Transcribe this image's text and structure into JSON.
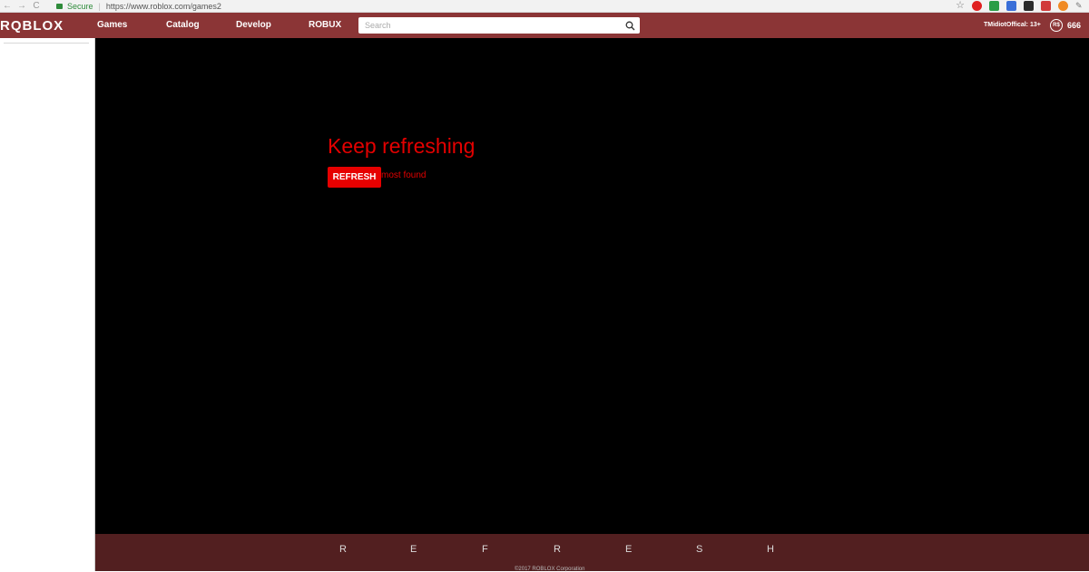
{
  "browser": {
    "secure_label": "Secure",
    "separator": "|",
    "url": "https://www.roblox.com/games2",
    "back": "←",
    "forward": "→",
    "reload": "C",
    "bookmark_icon": "star-icon",
    "extension_colors": [
      "#e02020",
      "#2a9d46",
      "#3a6fd8",
      "#2b2b2b",
      "#d13b3b",
      "#f08a24"
    ]
  },
  "header": {
    "logo": "RQBLOX",
    "nav": [
      "Games",
      "Catalog",
      "Develop",
      "ROBUX"
    ],
    "search_placeholder": "Search",
    "username": "TMidiotOffical: 13+",
    "robux_symbol": "R$",
    "robux_count": "666",
    "bg_color": "#8b3536"
  },
  "main": {
    "title": "Keep refreshing",
    "refresh_label": "REFRESH",
    "not_found_text": "most found",
    "accent_color": "#e30000",
    "bg_color": "#000000"
  },
  "footer": {
    "letters": [
      "R",
      "E",
      "F",
      "R",
      "E",
      "S",
      "H"
    ],
    "copyright": "©2017 ROBLOX Corporation",
    "bg_color": "#521f20"
  }
}
